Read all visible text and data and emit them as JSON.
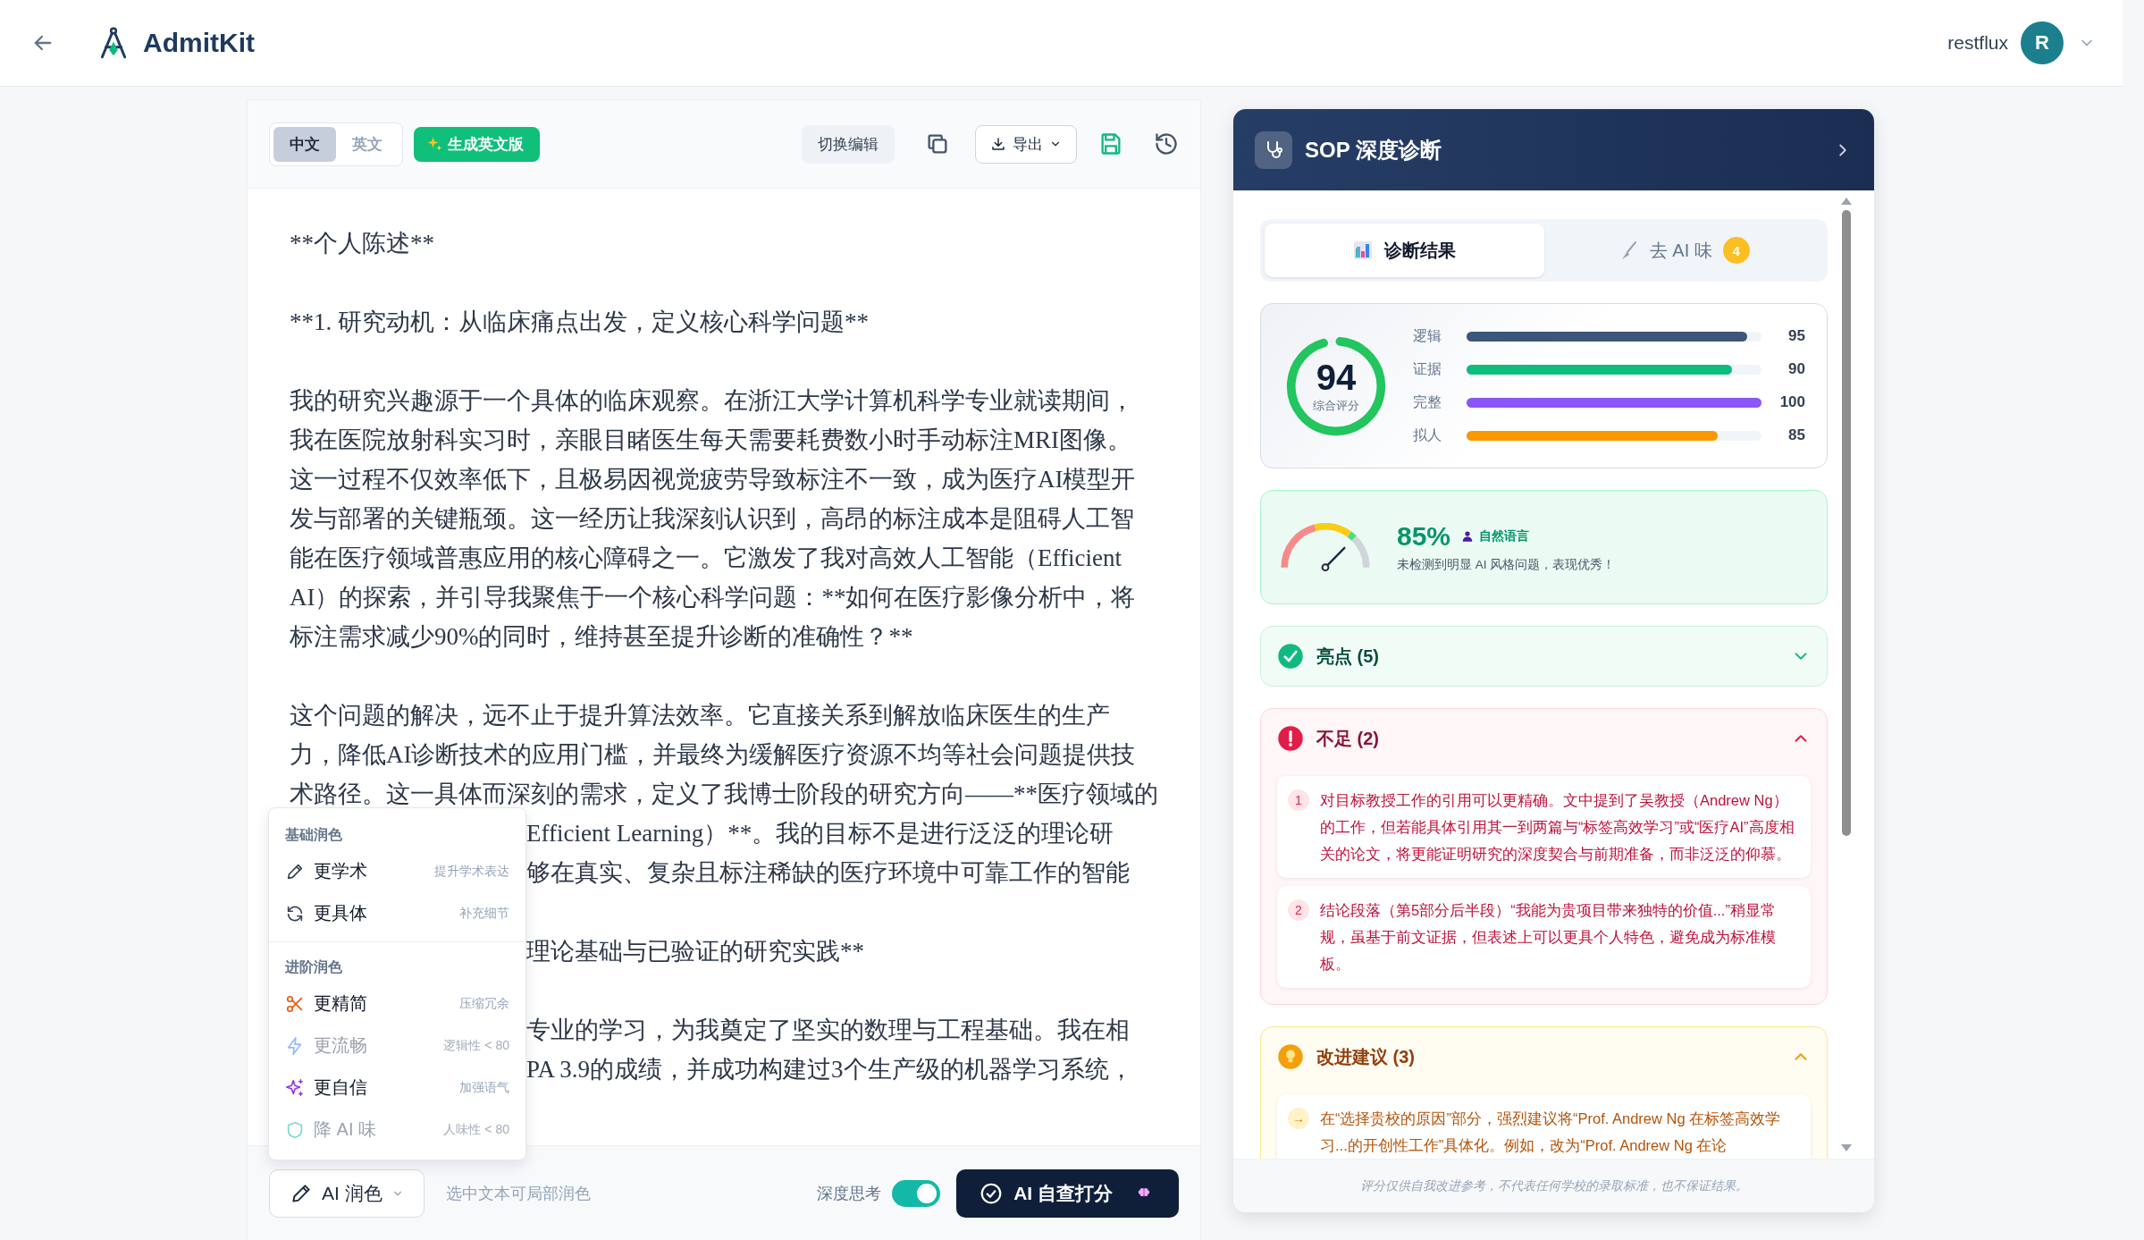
{
  "app": {
    "title": "AdmitKit",
    "user": "restflux",
    "avatar": "R"
  },
  "editor": {
    "languages": [
      {
        "label": "中文",
        "selected": true
      },
      {
        "label": "英文",
        "selected": false
      }
    ],
    "generate_button": "生成英文版",
    "switch_button": "切换编辑",
    "export_button": "导出",
    "blocks": [
      {
        "kind": "paragraph",
        "lines": [
          "**个人陈述**"
        ]
      },
      {
        "kind": "paragraph",
        "lines": [
          "**1. 研究动机：从临床痛点出发，定义核心科学问题**"
        ]
      },
      {
        "kind": "paragraph",
        "lines": [
          "我的研究兴趣源于一个具体的临床观察。在浙江大学计算机科学专业就读期间，",
          "我在医院放射科实习时，亲眼目睹医生每天需要耗费数小时手动标注MRI图像。",
          "这一过程不仅效率低下，且极易因视觉疲劳导致标注不一致，成为医疗AI模型开",
          "发与部署的关键瓶颈。这一经历让我深刻认识到，高昂的标注成本是阻碍人工智",
          "能在医疗领域普惠应用的核心障碍之一。它激发了我对高效人工智能（Efficient",
          "AI）的探索，并引导我聚焦于一个核心科学问题：**如何在医疗影像分析中，将",
          "标注需求减少90%的同时，维持甚至提升诊断的准确性？**"
        ]
      },
      {
        "kind": "paragraph",
        "lines": [
          "这个问题的解决，远不止于提升算法效率。它直接关系到解放临床医生的生产",
          "力，降低AI诊断技术的应用门槛，并最终为缓解医疗资源不均等社会问题提供技",
          "术路径。这一具体而深刻的需求，定义了我博士阶段的研究方向——**医疗领域的"
        ]
      },
      {
        "kind": "covered",
        "lines": [
          "Efficient Learning）**。我的目标不是进行泛泛的理论研",
          "够在真实、复杂且标注稀缺的医疗环境中可靠工作的智能"
        ]
      },
      {
        "kind": "covered",
        "lines": [
          "理论基础与已验证的研究实践**"
        ]
      },
      {
        "kind": "covered",
        "lines": [
          "专业的学习，为我奠定了坚实的数理与工程基础。我在相",
          "PA 3.9的成绩，并成功构建过3个生产级的机器学习系统，"
        ]
      }
    ]
  },
  "polish_menu": {
    "groups": [
      {
        "title": "基础润色",
        "items": [
          {
            "label": "更学术",
            "hint": "提升学术表达",
            "disabled": false
          },
          {
            "label": "更具体",
            "hint": "补充细节",
            "disabled": false
          }
        ]
      },
      {
        "title": "进阶润色",
        "items": [
          {
            "label": "更精简",
            "hint": "压缩冗余",
            "disabled": false
          },
          {
            "label": "更流畅",
            "hint": "逻辑性 < 80",
            "disabled": true
          },
          {
            "label": "更自信",
            "hint": "加强语气",
            "disabled": false
          },
          {
            "label": "降 AI 味",
            "hint": "人味性 < 80",
            "disabled": true
          }
        ]
      }
    ]
  },
  "bottom_bar": {
    "polish_button": "AI 润色",
    "hint": "选中文本可局部润色",
    "deep_think": {
      "label": "深度思考",
      "on": true
    },
    "score_button": "AI 自查打分"
  },
  "diagnosis": {
    "title": "SOP 深度诊断",
    "tabs": [
      {
        "label": "诊断结果",
        "selected": true
      },
      {
        "label": "去 AI 味",
        "selected": false,
        "badge": "4"
      }
    ],
    "score": {
      "value": "94",
      "label": "综合评分",
      "level": 0.94
    },
    "metrics": [
      {
        "name": "逻辑",
        "level": 0.95,
        "value": "95",
        "color": "#3d5579"
      },
      {
        "name": "证据",
        "level": 0.9,
        "value": "90",
        "color": "#0dbd7e"
      },
      {
        "name": "完整",
        "level": 1.0,
        "value": "100",
        "color": "#8b55f7"
      },
      {
        "name": "拟人",
        "level": 0.85,
        "value": "85",
        "color": "#fb9800"
      }
    ],
    "humanness": {
      "value": "85%",
      "tag": "自然语言",
      "note": "未检测到明显 AI 风格问题，表现优秀！",
      "level": 0.85
    },
    "sections": [
      {
        "kind": "strengths",
        "title": "亮点 (5)",
        "expanded": false
      },
      {
        "kind": "weaknesses",
        "title": "不足 (2)",
        "expanded": true,
        "items": [
          {
            "marker": "1",
            "text": "对目标教授工作的引用可以更精确。文中提到了吴教授（Andrew Ng）的工作，但若能具体引用其一到两篇与“标签高效学习”或“医疗AI”高度相关的论文，将更能证明研究的深度契合与前期准备，而非泛泛的仰慕。"
          },
          {
            "marker": "2",
            "text": "结论段落（第5部分后半段）“我能为贵项目带来独特的价值...”稍显常规，虽基于前文证据，但表述上可以更具个人特色，避免成为标准模板。"
          }
        ]
      },
      {
        "kind": "suggestions",
        "title": "改进建议 (3)",
        "expanded": true,
        "items": [
          {
            "marker": "→",
            "text": "在“选择贵校的原因”部分，强烈建议将“Prof. Andrew Ng 在标签高效学习...的开创性工作”具体化。例如，改为“Prof. Andrew Ng 在论"
          }
        ]
      }
    ],
    "footer": "评分仅供自我改进参考，不代表任何学校的录取标准，也不保证结果。"
  }
}
